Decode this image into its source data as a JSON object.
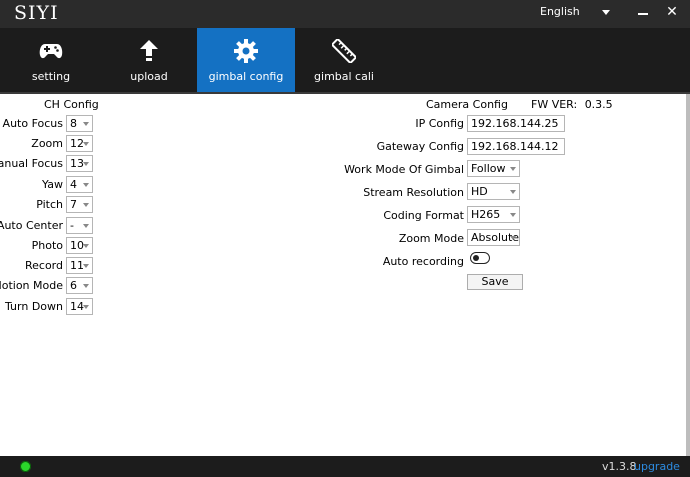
{
  "app": {
    "logo": "SIYI",
    "language": "English",
    "close_symbol": "✕"
  },
  "toolbar": {
    "items": [
      {
        "label": "setting",
        "icon": "gamepad-icon",
        "active": false
      },
      {
        "label": "upload",
        "icon": "upload-arrow-icon",
        "active": false
      },
      {
        "label": "gimbal config",
        "icon": "gear-icon",
        "active": true
      },
      {
        "label": "gimbal cali",
        "icon": "ruler-icon",
        "active": false
      }
    ],
    "active_color": "#1471c3"
  },
  "ch_config": {
    "title": "CH Config",
    "rows": [
      {
        "label": "Auto Focus",
        "value": "8"
      },
      {
        "label": "Zoom",
        "value": "12"
      },
      {
        "label": "Manual Focus",
        "value": "13"
      },
      {
        "label": "Yaw",
        "value": "4"
      },
      {
        "label": "Pitch",
        "value": "7"
      },
      {
        "label": "Auto Center",
        "value": "-"
      },
      {
        "label": "Photo",
        "value": "10"
      },
      {
        "label": "Record",
        "value": "11"
      },
      {
        "label": "Motion Mode",
        "value": "6"
      },
      {
        "label": "Turn Down",
        "value": "14"
      }
    ]
  },
  "camera_config": {
    "title": "Camera Config",
    "fw_label": "FW VER:",
    "fw_value": "0.3.5",
    "ip_label": "IP Config",
    "ip_value": "192.168.144.25",
    "gateway_label": "Gateway Config",
    "gateway_value": "192.168.144.12",
    "work_mode_label": "Work Mode Of Gimbal",
    "work_mode_value": "Follow",
    "stream_label": "Stream Resolution",
    "stream_value": "HD",
    "coding_label": "Coding Format",
    "coding_value": "H265",
    "zoom_mode_label": "Zoom Mode",
    "zoom_mode_value": "Absolute",
    "auto_recording_label": "Auto recording",
    "auto_recording_on": false,
    "save_label": "Save"
  },
  "status": {
    "version": "v1.3.8",
    "upgrade_label": "upgrade",
    "led_color": "#2bd62b"
  }
}
